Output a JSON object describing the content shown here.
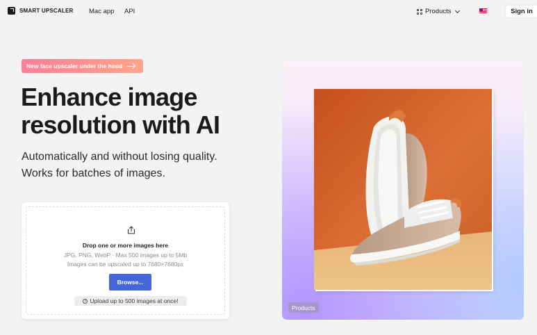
{
  "header": {
    "logo_text": "SMART UPSCALER",
    "nav": [
      "Mac app",
      "API"
    ],
    "products_label": "Products",
    "signin_label": "Sign in"
  },
  "hero": {
    "pill_label": "New face upscaler under the hood",
    "headline_line1": "Enhance image",
    "headline_line2": "resolution with AI",
    "subhead_line1": "Automatically and without losing quality.",
    "subhead_line2": "Works for batches of images."
  },
  "upload": {
    "title": "Drop one or more images here",
    "line1": "JPG, PNG, WebP · Max 500 images up to 5Mb",
    "line2": "Images can be upscaled up to 7680×7680px",
    "browse_label": "Browse...",
    "badge_label": "Upload up to 500 images at once!"
  },
  "visual": {
    "tag_label": "Products"
  },
  "colors": {
    "accent_blue": "#4466d8",
    "pill_gradient_start": "#ff7e96",
    "pill_gradient_end": "#ffa58a",
    "photo_background": "#d96a2e"
  }
}
